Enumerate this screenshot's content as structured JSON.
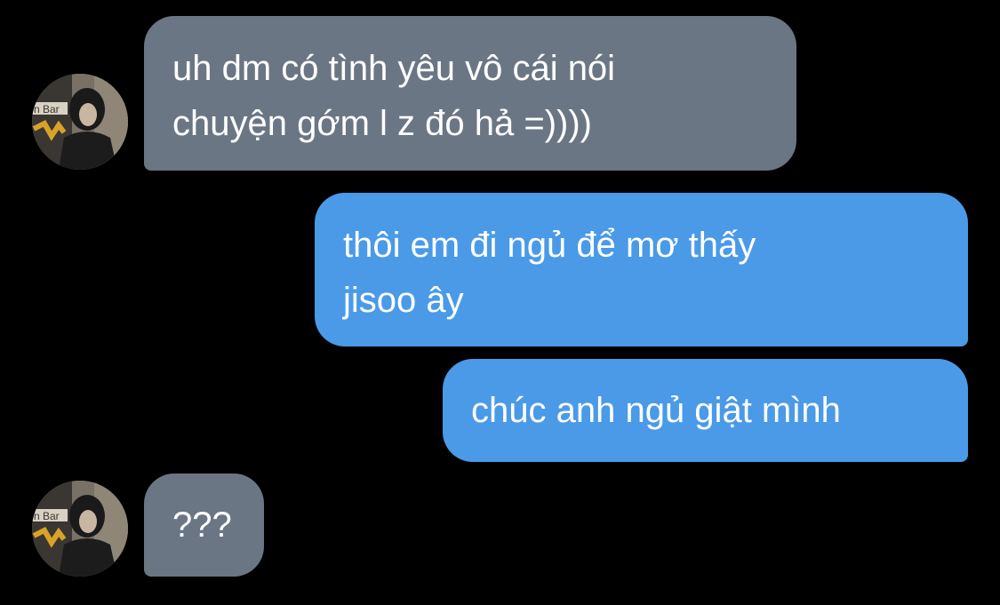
{
  "conversation": {
    "messages": [
      {
        "direction": "incoming",
        "text": "uh dm có tình yêu vô cái nói\nchuyện gớm l z đó hả =))))"
      },
      {
        "direction": "outgoing",
        "text": "thôi em đi ngủ để mơ thấy\njisoo ây"
      },
      {
        "direction": "outgoing",
        "text": "chúc anh ngủ giật mình"
      },
      {
        "direction": "incoming",
        "text": "???"
      }
    ],
    "avatar_sign_text": "n Bar"
  },
  "colors": {
    "background": "#000000",
    "incoming_bubble": "#6a7683",
    "outgoing_bubble": "#4a9ae8",
    "text": "#ffffff"
  }
}
